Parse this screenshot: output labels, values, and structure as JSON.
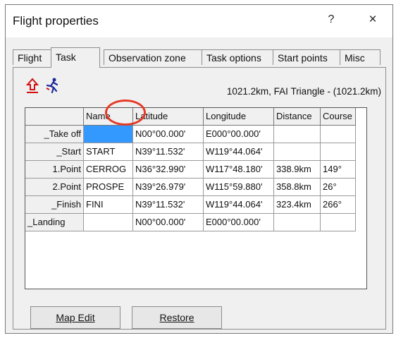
{
  "window": {
    "title": "Flight properties",
    "help_label": "?",
    "close_label": "×"
  },
  "tabs": [
    {
      "label": "Flight",
      "active": false
    },
    {
      "label": "Task",
      "active": true
    },
    {
      "label": "Observation zone",
      "active": false
    },
    {
      "label": "Task options",
      "active": false
    },
    {
      "label": "Start points",
      "active": false
    },
    {
      "label": "Misc",
      "active": false
    }
  ],
  "task": {
    "summary": "1021.2km, FAI Triangle - (1021.2km)",
    "icons": [
      "takeoff-arrow-icon",
      "runner-icon"
    ]
  },
  "grid": {
    "headers": [
      "",
      "Name",
      "Latitude",
      "Longitude",
      "Distance",
      "Course"
    ],
    "rows": [
      [
        "_Take off",
        "",
        "N00°00.000'",
        "E000°00.000'",
        "",
        ""
      ],
      [
        "_Start",
        "START",
        "N39°11.532'",
        "W119°44.064'",
        "",
        ""
      ],
      [
        "1.Point",
        "CERROG",
        "N36°32.990'",
        "W117°48.180'",
        "338.9km",
        "149°"
      ],
      [
        "2.Point",
        "PROSPE",
        "N39°26.979'",
        "W115°59.880'",
        "358.8km",
        "26°"
      ],
      [
        "_Finish",
        "FINI",
        "N39°11.532'",
        "W119°44.064'",
        "323.4km",
        "266°"
      ],
      [
        "_Landing",
        "",
        "N00°00.000'",
        "E000°00.000'",
        "",
        ""
      ]
    ],
    "lock_icon": "lock-icon",
    "highlight_color": "#e53a28",
    "selection_color": "#3399ff"
  },
  "buttons": {
    "map_edit": "Map Edit",
    "restore": "Restore"
  }
}
